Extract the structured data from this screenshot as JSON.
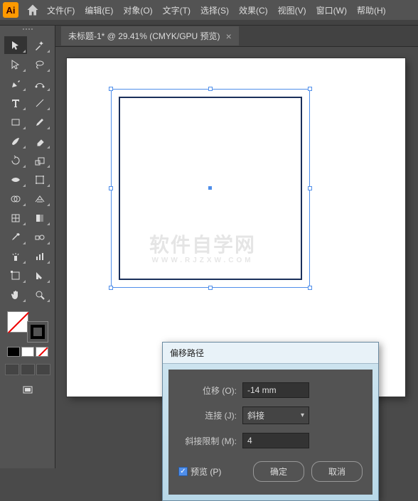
{
  "app": {
    "icon_label": "Ai"
  },
  "menu": {
    "file": "文件(F)",
    "edit": "编辑(E)",
    "object": "对象(O)",
    "type": "文字(T)",
    "select": "选择(S)",
    "effect": "效果(C)",
    "view": "视图(V)",
    "window": "窗口(W)",
    "help": "帮助(H)"
  },
  "document": {
    "tab_label": "未标题-1* @ 29.41% (CMYK/GPU 预览)",
    "close_glyph": "×"
  },
  "watermark": {
    "main": "软件自学网",
    "sub": "WWW.RJZXW.COM"
  },
  "dialog": {
    "title": "偏移路径",
    "offset_label": "位移 (O):",
    "offset_value": "-14 mm",
    "join_label": "连接 (J):",
    "join_value": "斜接",
    "miter_label": "斜接限制 (M):",
    "miter_value": "4",
    "preview_label": "预览 (P)",
    "ok": "确定",
    "cancel": "取消"
  }
}
